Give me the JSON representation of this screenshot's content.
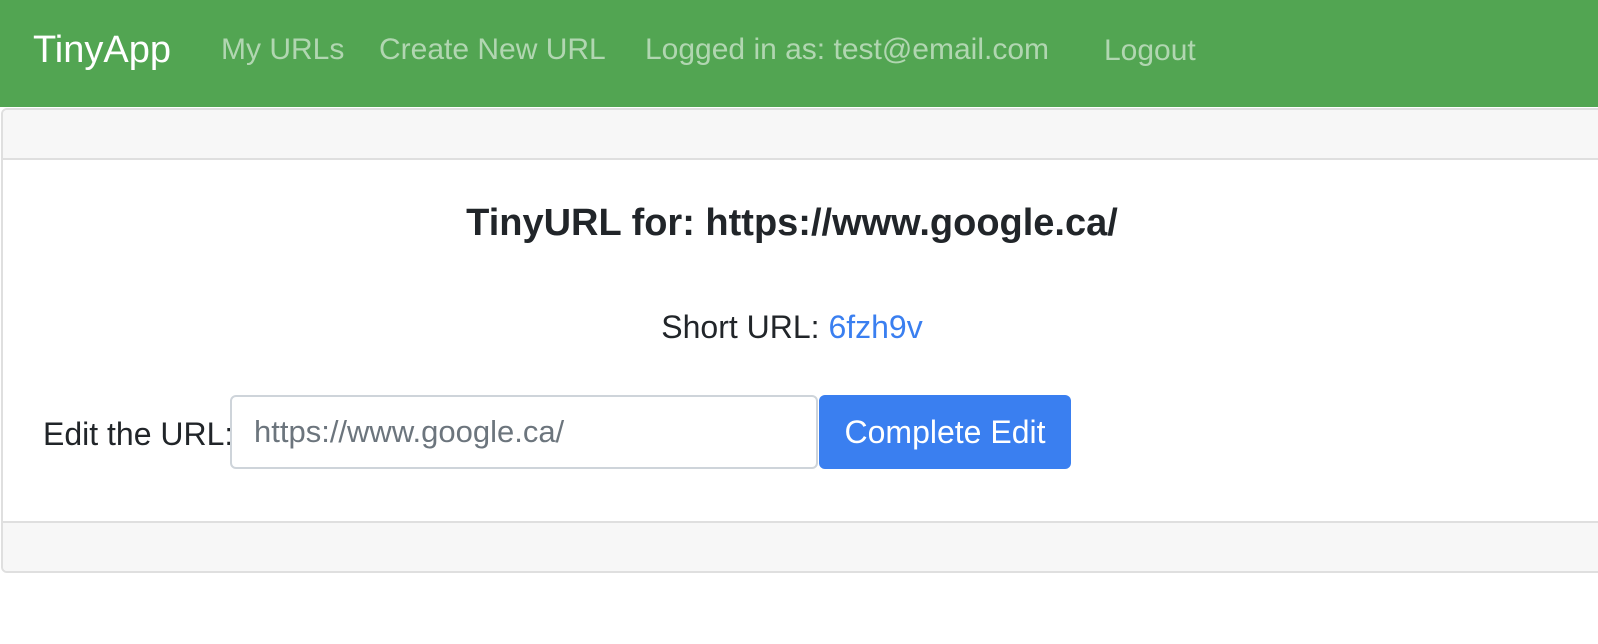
{
  "navbar": {
    "brand": "TinyApp",
    "links": {
      "my_urls": "My URLs",
      "create_new": "Create New URL"
    },
    "logged_in_text": "Logged in as: test@email.com",
    "logout_label": "Logout",
    "background_color": "#52a552"
  },
  "card": {
    "title": "TinyURL for: https://www.google.ca/",
    "short_url_label": "Short URL: ",
    "short_url_value": "6fzh9v",
    "edit": {
      "label": "Edit the URL:",
      "placeholder": "https://www.google.ca/",
      "submit_label": "Complete Edit"
    }
  },
  "colors": {
    "link": "#3a7ff0",
    "primary_button": "#3a7ff0"
  }
}
